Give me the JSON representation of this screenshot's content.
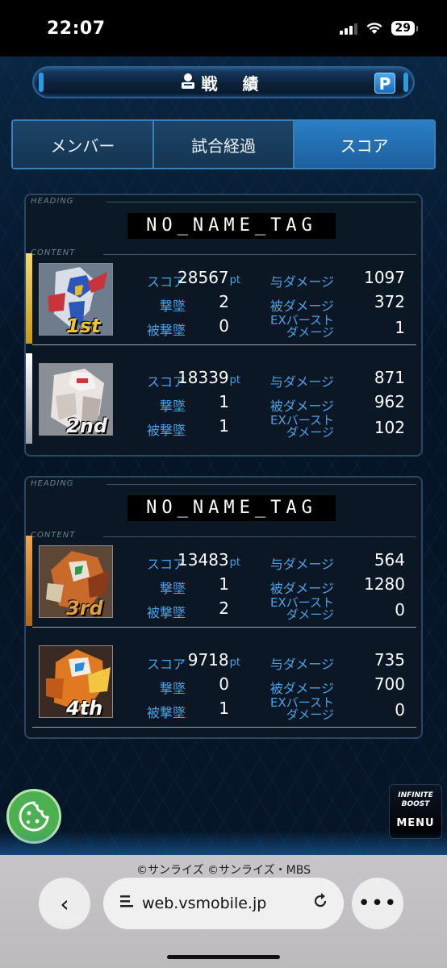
{
  "status": {
    "time": "22:07",
    "battery": "29"
  },
  "header": {
    "title_icon": "戦",
    "title": "戦 績",
    "help": "P"
  },
  "tabs": [
    {
      "label": "メンバー",
      "active": false
    },
    {
      "label": "試合経過",
      "active": false
    },
    {
      "label": "スコア",
      "active": true
    }
  ],
  "labels": {
    "heading": "HEADING",
    "content": "CONTENT",
    "score": "スコア",
    "kills": "撃墜",
    "deaths": "被撃墜",
    "damage_dealt": "与ダメージ",
    "damage_taken": "被ダメージ",
    "ex_burst_line1": "EXバースト",
    "ex_burst_line2": "ダメージ",
    "pt": "pt"
  },
  "teams": [
    {
      "tag": "NO_NAME_TAG",
      "players": [
        {
          "rank": "1st",
          "rank_color": "#f1c232",
          "score": "28567",
          "kills": "2",
          "deaths": "0",
          "damage_dealt": "1097",
          "damage_taken": "372",
          "ex_burst": "1"
        },
        {
          "rank": "2nd",
          "rank_color": "#e6e6e6",
          "score": "18339",
          "kills": "1",
          "deaths": "1",
          "damage_dealt": "871",
          "damage_taken": "962",
          "ex_burst": "102"
        }
      ]
    },
    {
      "tag": "NO_NAME_TAG",
      "players": [
        {
          "rank": "3rd",
          "rank_color": "#e08a2c",
          "score": "13483",
          "kills": "1",
          "deaths": "2",
          "damage_dealt": "564",
          "damage_taken": "1280",
          "ex_burst": "0"
        },
        {
          "rank": "4th",
          "rank_color": "",
          "score": "9718",
          "kills": "0",
          "deaths": "1",
          "damage_dealt": "735",
          "damage_taken": "700",
          "ex_burst": "0"
        }
      ]
    }
  ],
  "menu": {
    "logo_line1": "INFINITE",
    "logo_line2": "BOOST",
    "label": "MENU"
  },
  "browser": {
    "copyright": "©サンライズ ©サンライズ・MBS",
    "url": "web.vsmobile.jp",
    "back": "‹",
    "more": "•••"
  }
}
